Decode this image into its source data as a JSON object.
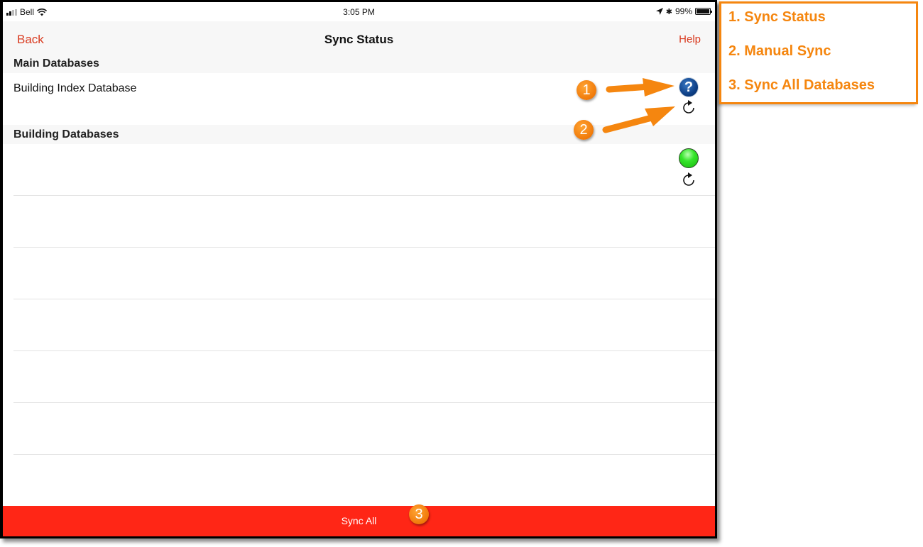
{
  "status_bar": {
    "carrier": "Bell",
    "time": "3:05 PM",
    "battery": "99%",
    "icons": [
      "signal-icon",
      "wifi-icon",
      "location-arrow-icon",
      "bluetooth-icon",
      "battery-icon"
    ]
  },
  "nav": {
    "back_label": "Back",
    "title": "Sync Status",
    "help_label": "Help"
  },
  "sections": [
    {
      "header": "Main Databases",
      "rows": [
        {
          "label": "Building Index Database",
          "status": "unknown",
          "status_icon": "question-mark-icon",
          "sync_icon": "refresh-icon"
        }
      ]
    },
    {
      "header": "Building Databases",
      "rows": [
        {
          "label": "",
          "status": "synced",
          "status_icon": "green-status-icon",
          "sync_icon": "refresh-icon"
        },
        {
          "label": ""
        },
        {
          "label": ""
        },
        {
          "label": ""
        },
        {
          "label": ""
        },
        {
          "label": ""
        },
        {
          "label": ""
        }
      ]
    }
  ],
  "sync_all": {
    "label": "Sync All"
  },
  "annotations": {
    "badges": [
      "1",
      "2",
      "3"
    ],
    "legend": [
      "1. Sync Status",
      "2. Manual Sync",
      "3. Sync All Databases"
    ]
  },
  "colors": {
    "accent_red": "#d93a1f",
    "sync_all_bg": "#ff2616",
    "annotation_orange": "#f5860f",
    "status_ok_green": "#35e52a",
    "status_unknown_blue": "#0d3f86"
  }
}
